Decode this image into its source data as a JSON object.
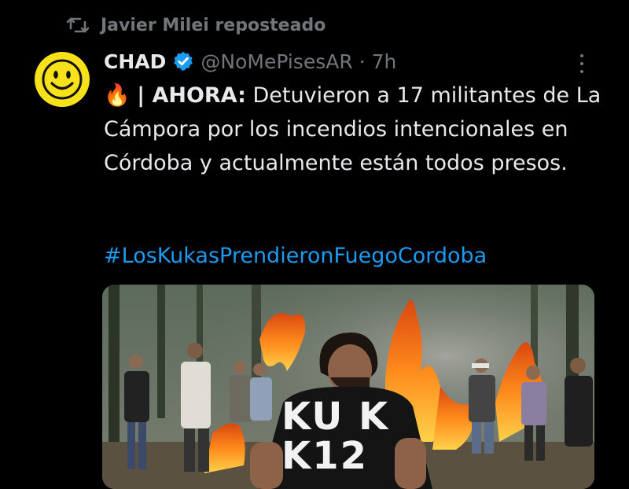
{
  "repost": {
    "icon": "repost-icon",
    "label": "Javier Milei reposteado"
  },
  "tweet": {
    "author_name": "CHAD",
    "verified_color": "#1d9bf0",
    "handle": "@NoMePisesAR",
    "separator": "·",
    "time": "7h",
    "text_prefix": "| AHORA:",
    "text_body": " Detuvieron a 17 militantes de La Cámpora por los incendios intencionales en Córdoba y actualmente están todos presos.",
    "emoji": "🔥",
    "hashtag": "#LosKukasPrendieronFuegoCordoba",
    "media": {
      "shirt_line1": "KU K",
      "shirt_line2": "K12"
    }
  },
  "colors": {
    "background": "#000000",
    "text": "#e7e9ea",
    "secondary": "#71767b",
    "link": "#1d9bf0",
    "avatar_bg": "#f7e11a"
  }
}
